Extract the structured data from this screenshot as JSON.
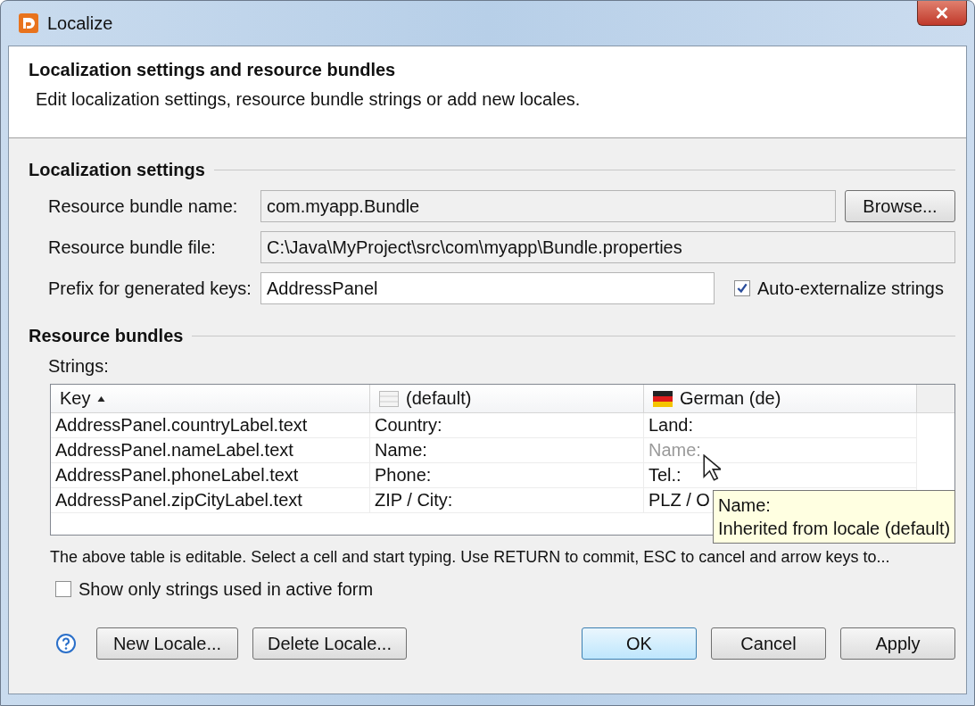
{
  "window": {
    "title": "Localize"
  },
  "header": {
    "title": "Localization settings and resource bundles",
    "description": "Edit localization settings, resource bundle strings or add new locales."
  },
  "localization_settings": {
    "heading": "Localization settings",
    "bundle_name": {
      "label": "Resource bundle name:",
      "value": "com.myapp.Bundle",
      "button": "Browse..."
    },
    "bundle_file": {
      "label": "Resource bundle file:",
      "value": "C:\\Java\\MyProject\\src\\com\\myapp\\Bundle.properties"
    },
    "prefix": {
      "label": "Prefix for generated keys:",
      "value": "AddressPanel"
    },
    "auto_externalize": {
      "label": "Auto-externalize strings",
      "checked": true
    }
  },
  "resource_bundles": {
    "heading": "Resource bundles",
    "strings_label": "Strings:",
    "table": {
      "columns": [
        {
          "label": "Key",
          "sorted": true,
          "kind": "key"
        },
        {
          "label": "(default)",
          "sorted": false,
          "kind": "default-locale"
        },
        {
          "label": "German (de)",
          "sorted": false,
          "kind": "german-locale"
        }
      ],
      "rows": [
        {
          "cells": [
            {
              "text": "AddressPanel.countryLabel.text",
              "inherited": false
            },
            {
              "text": "Country:",
              "inherited": false
            },
            {
              "text": "Land:",
              "inherited": false
            }
          ]
        },
        {
          "cells": [
            {
              "text": "AddressPanel.nameLabel.text",
              "inherited": false
            },
            {
              "text": "Name:",
              "inherited": false
            },
            {
              "text": "Name:",
              "inherited": true
            }
          ]
        },
        {
          "cells": [
            {
              "text": "AddressPanel.phoneLabel.text",
              "inherited": false
            },
            {
              "text": "Phone:",
              "inherited": false
            },
            {
              "text": "Tel.:",
              "inherited": false
            }
          ]
        },
        {
          "cells": [
            {
              "text": "AddressPanel.zipCityLabel.text",
              "inherited": false
            },
            {
              "text": "ZIP / City:",
              "inherited": false
            },
            {
              "text": "PLZ / O",
              "inherited": false
            }
          ]
        }
      ]
    },
    "tooltip": {
      "title": "Name:",
      "text": "Inherited from locale (default)"
    },
    "hint": "The above table is editable. Select a cell and start typing. Use RETURN to commit, ESC to cancel and arrow keys to...",
    "show_only_used": {
      "label": "Show only strings used in active form",
      "checked": false
    }
  },
  "buttons": [
    {
      "label": "New Locale...",
      "default": false
    },
    {
      "label": "Delete Locale...",
      "default": false
    },
    {
      "label": "OK",
      "default": true
    },
    {
      "label": "Cancel",
      "default": false
    },
    {
      "label": "Apply",
      "default": false
    }
  ]
}
